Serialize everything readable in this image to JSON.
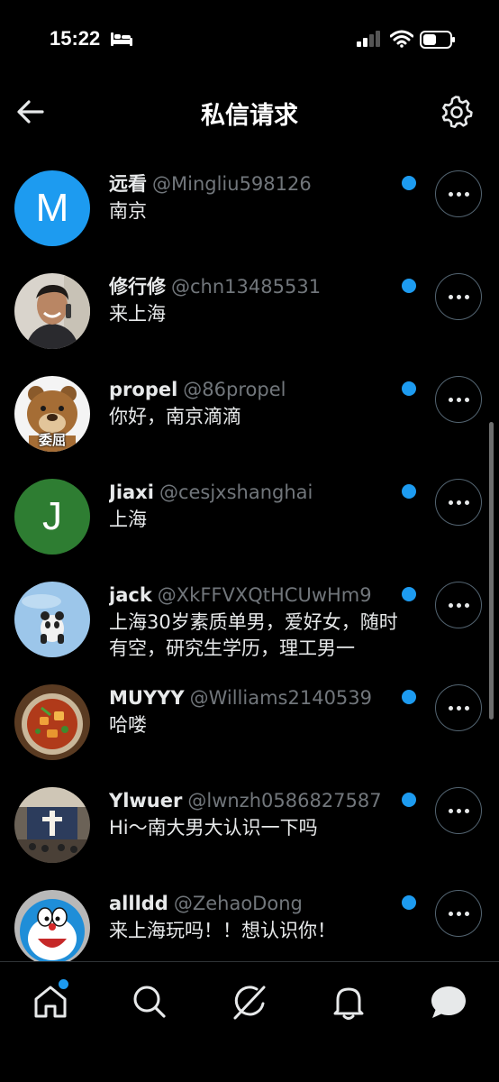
{
  "status_bar": {
    "time": "15:22"
  },
  "header": {
    "title": "私信请求"
  },
  "requests": [
    {
      "name": "远看",
      "handle": "@Mingliu598126",
      "message": "南京",
      "avatar_letter": "M",
      "avatar_color": "#1d9bf0",
      "unread": true
    },
    {
      "name": "修行修",
      "handle": "@chn13485531",
      "message": "来上海",
      "unread": true
    },
    {
      "name": "propel",
      "handle": "@86propel",
      "message": "你好，南京滴滴",
      "avatar_caption": "委屈",
      "unread": true
    },
    {
      "name": "Jiaxi",
      "handle": "@cesjxshanghai",
      "message": "上海",
      "avatar_letter": "J",
      "avatar_color": "#2e7d32",
      "unread": true
    },
    {
      "name": "jack",
      "handle": "@XkFFVXQtHCUwHm9",
      "message": "上海30岁素质单男，爱好女，随时有空，研究生学历，理工男一",
      "unread": true
    },
    {
      "name": "MUYYY",
      "handle": "@Williams2140539",
      "message": "哈喽",
      "unread": true
    },
    {
      "name": "Ylwuer",
      "handle": "@lwnzh0586827587",
      "message": "Hi～南大男大认识一下吗",
      "unread": true
    },
    {
      "name": "allldd",
      "handle": "@ZehaoDong",
      "message": "来上海玩吗！！想认识你！",
      "unread": true
    }
  ],
  "bottom_nav": [
    {
      "icon": "home-icon",
      "badge": true
    },
    {
      "icon": "search-icon"
    },
    {
      "icon": "grok-icon"
    },
    {
      "icon": "notifications-icon"
    },
    {
      "icon": "messages-icon"
    }
  ],
  "colors": {
    "background": "#000000",
    "accent": "#1d9bf0",
    "secondary_text": "#71767b"
  }
}
